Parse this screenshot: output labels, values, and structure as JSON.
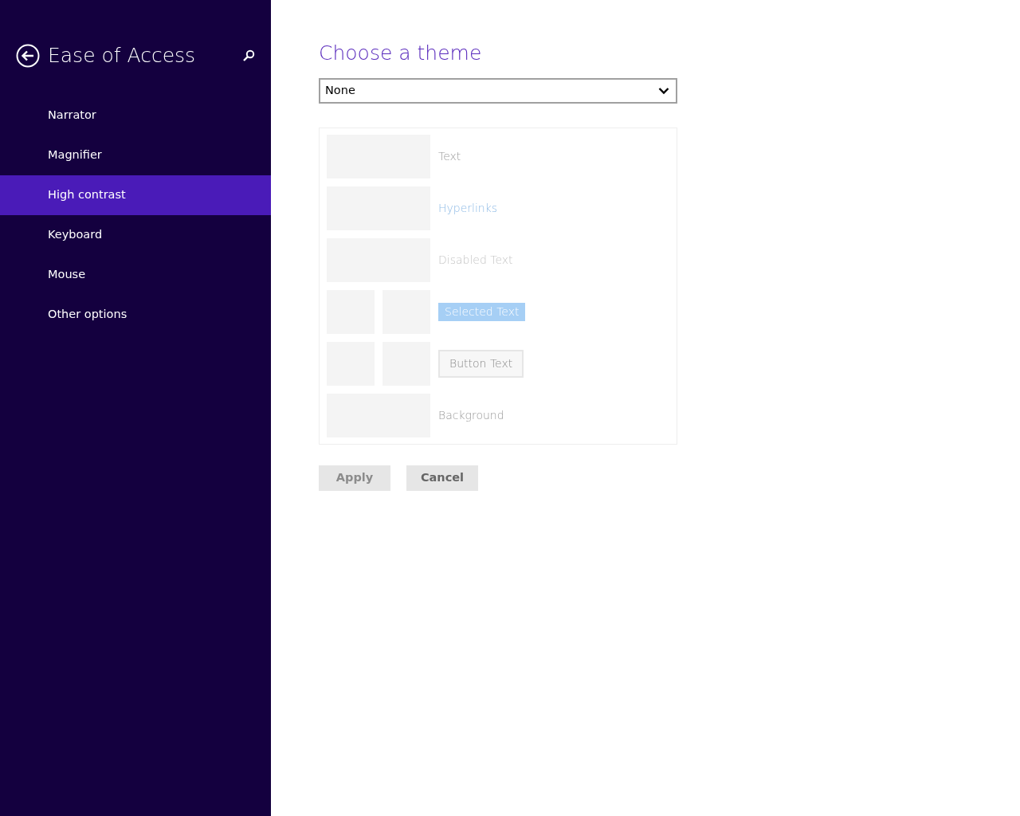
{
  "sidebar": {
    "title": "Ease of Access",
    "items": [
      {
        "label": "Narrator",
        "selected": false
      },
      {
        "label": "Magnifier",
        "selected": false
      },
      {
        "label": "High contrast",
        "selected": true
      },
      {
        "label": "Keyboard",
        "selected": false
      },
      {
        "label": "Mouse",
        "selected": false
      },
      {
        "label": "Other options",
        "selected": false
      }
    ]
  },
  "content": {
    "heading": "Choose a theme",
    "theme_select": {
      "value": "None"
    },
    "preview": [
      {
        "kind": "text",
        "label": "Text"
      },
      {
        "kind": "link",
        "label": "Hyperlinks"
      },
      {
        "kind": "disabled",
        "label": "Disabled Text"
      },
      {
        "kind": "selected",
        "label": "Selected Text"
      },
      {
        "kind": "button",
        "label": "Button Text"
      },
      {
        "kind": "background",
        "label": "Background"
      }
    ],
    "buttons": [
      {
        "label": "Apply",
        "disabled": true
      },
      {
        "label": "Cancel",
        "disabled": false
      }
    ]
  }
}
